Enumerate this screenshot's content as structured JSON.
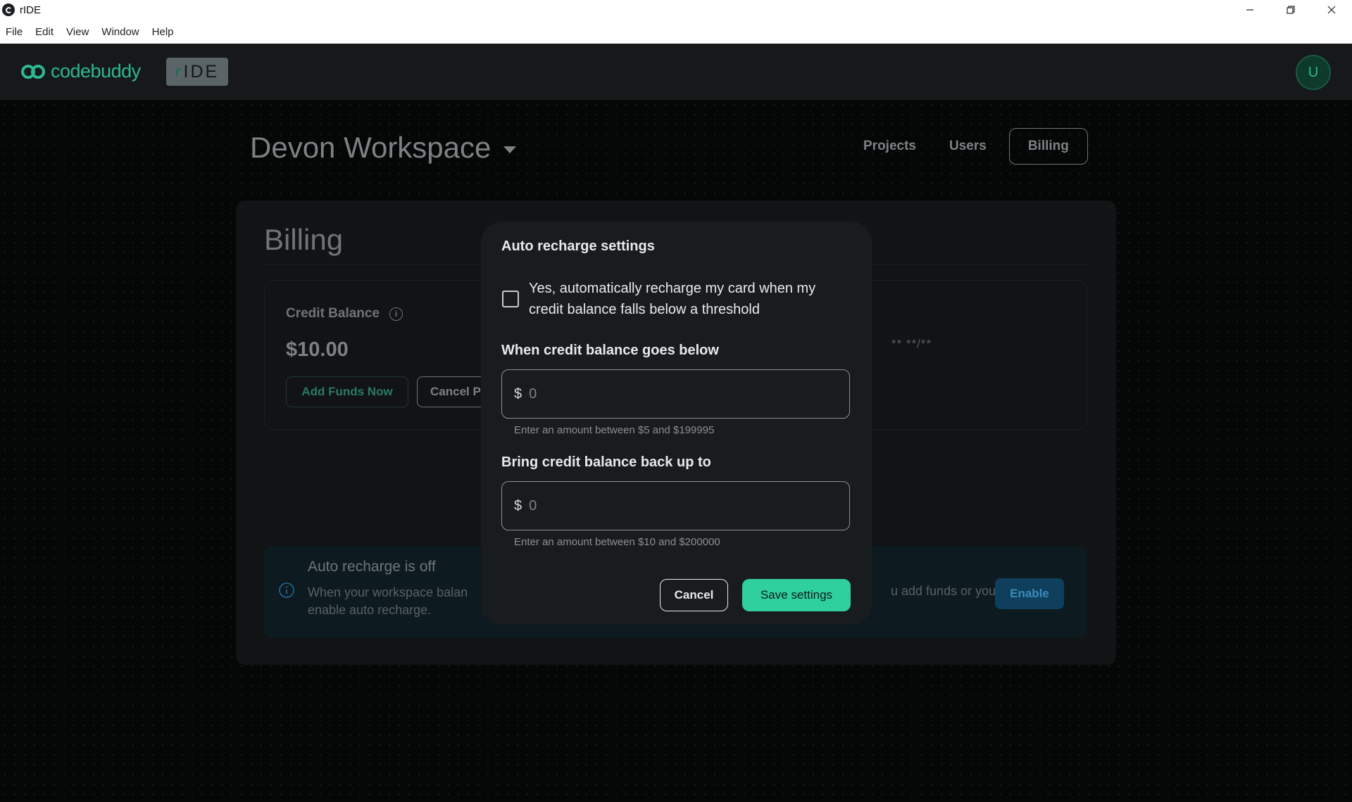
{
  "window": {
    "title": "rIDE",
    "icon": "ride-app-icon",
    "controls": [
      "minimize",
      "restore",
      "close"
    ]
  },
  "menu": {
    "items": [
      "File",
      "Edit",
      "View",
      "Window",
      "Help"
    ]
  },
  "header": {
    "logo_text": "codebuddy",
    "ide_badge_mark": "r",
    "ide_badge_text": "IDE",
    "avatar_initial": "U",
    "accent_color": "#2db894"
  },
  "workspace": {
    "name": "Devon Workspace",
    "nav": [
      "Projects",
      "Users",
      "Billing"
    ],
    "active_nav": "Billing"
  },
  "billing": {
    "title": "Billing",
    "credit_label": "Credit Balance",
    "credit_amount": "$10.00",
    "add_funds_label": "Add Funds Now",
    "cancel_partial_label": "Cancel P",
    "card_masked": "** **/**",
    "auto_recharge_title": "Auto recharge is off",
    "auto_recharge_desc_left": "When your workspace balan",
    "auto_recharge_desc_right": "u add funds or you",
    "auto_recharge_desc_line2": "enable auto recharge.",
    "enable_label": "Enable"
  },
  "modal": {
    "title": "Auto recharge settings",
    "checkbox_checked": false,
    "checkbox_label": "Yes, automatically recharge my card when my credit balance falls below a threshold",
    "threshold_label": "When credit balance goes below",
    "threshold_currency": "$",
    "threshold_value": "0",
    "threshold_help": "Enter an amount between $5 and $199995",
    "target_label": "Bring credit balance back up to",
    "target_currency": "$",
    "target_value": "0",
    "target_help": "Enter an amount between $10 and $200000",
    "cancel_label": "Cancel",
    "save_label": "Save settings",
    "save_color": "#2fcf9e"
  }
}
